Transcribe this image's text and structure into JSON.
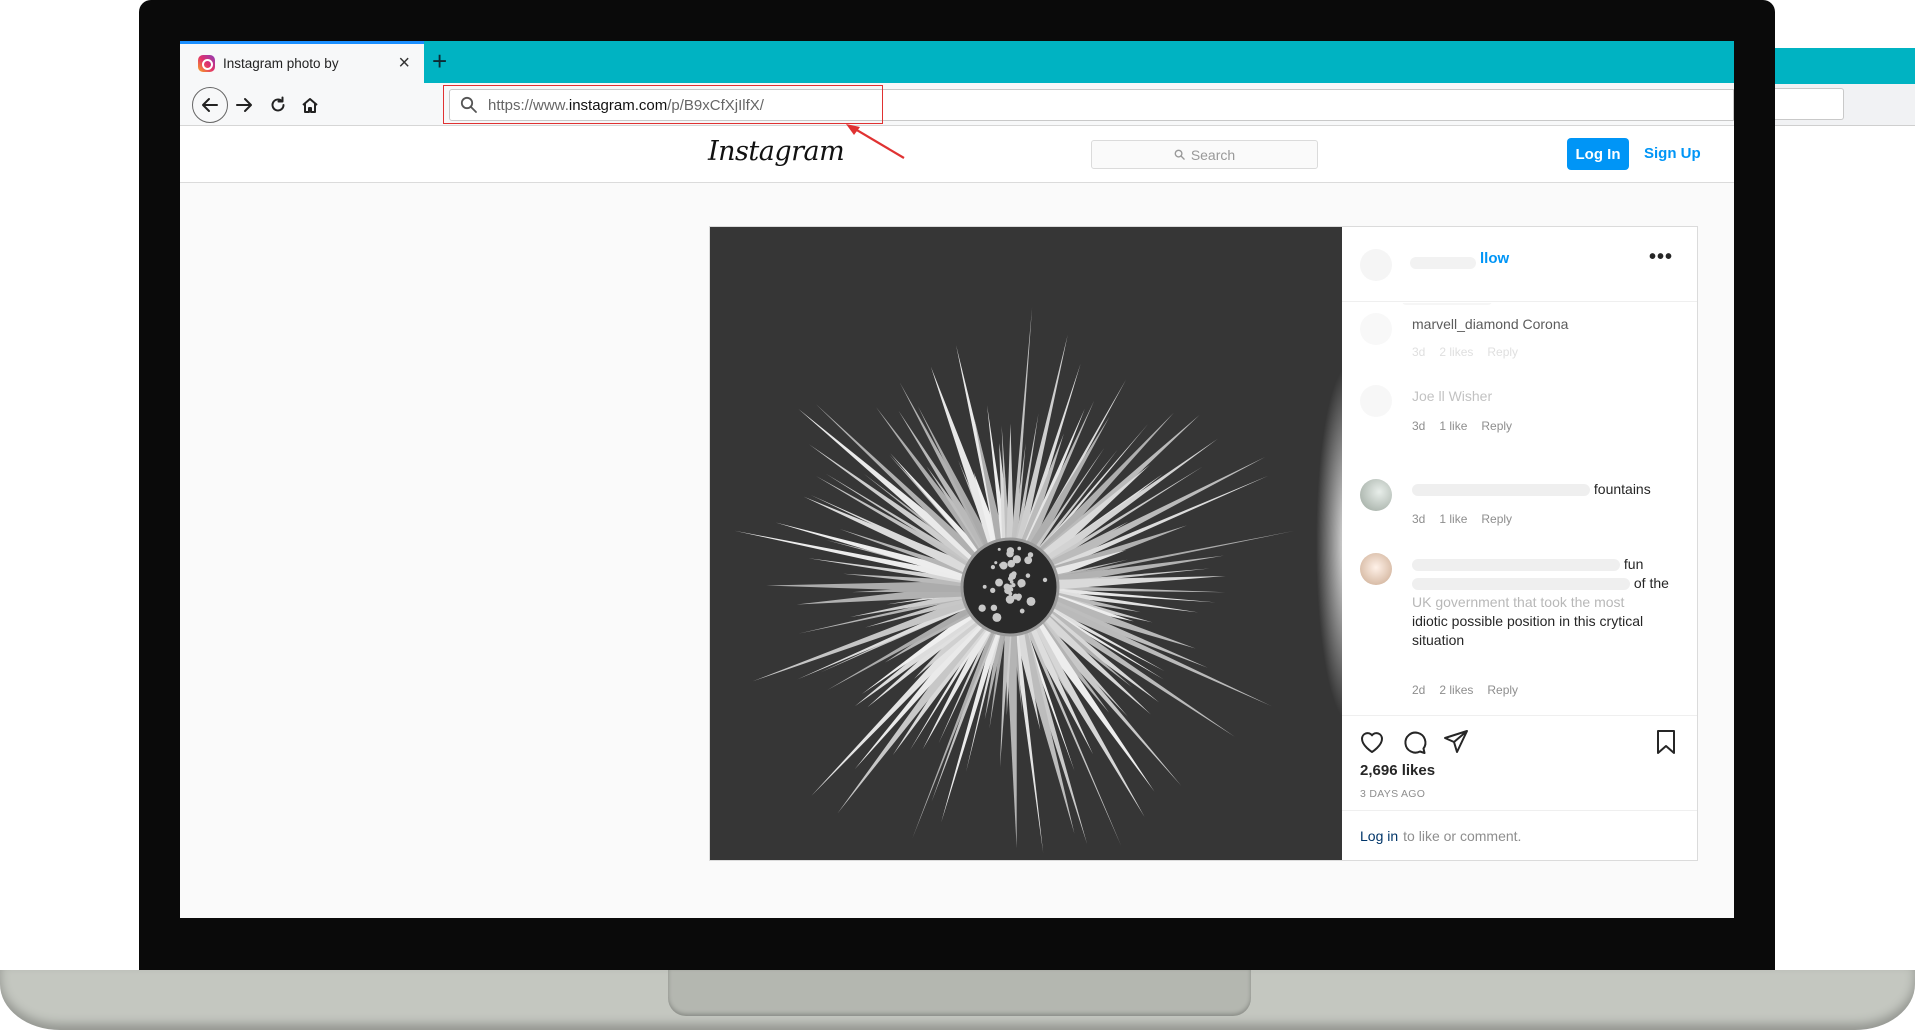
{
  "browser": {
    "tab_title": "Instagram photo by",
    "tab_close": "×",
    "new_tab": "+",
    "url_prefix": "https://www.",
    "url_domain": "instagram.com",
    "url_path": "/p/B9xCfXjIlfX/"
  },
  "header": {
    "logo": "Instagram",
    "search_placeholder": "Search",
    "login_label": "Log In",
    "signup_label": "Sign Up"
  },
  "post": {
    "follow_label": "llow",
    "more_label": "•••",
    "comments": [
      {
        "text": "marvell_diamond Corona",
        "time": "3d",
        "likes": "2 likes",
        "reply": "Reply"
      },
      {
        "text": "Joe ll Wisher",
        "time": "3d",
        "likes": "1 like",
        "reply": "Reply"
      },
      {
        "text": "fountains",
        "time": "3d",
        "likes": "1 like",
        "reply": "Reply"
      },
      {
        "text_l1": "fun",
        "text_l2": "of the",
        "text_l3": "UK government that took the most",
        "text_l4": "idiotic possible position in this crytical",
        "text_l5": "situation",
        "time": "2d",
        "likes": "2 likes",
        "reply": "Reply"
      }
    ],
    "likes": "2,696 likes",
    "date": "3 DAYS AGO",
    "login_link": "Log in",
    "login_suffix": "to like or comment."
  },
  "colors": {
    "tab_strip": "#00b3c2",
    "ig_blue": "#0095f6",
    "annotation_red": "#e03232"
  }
}
